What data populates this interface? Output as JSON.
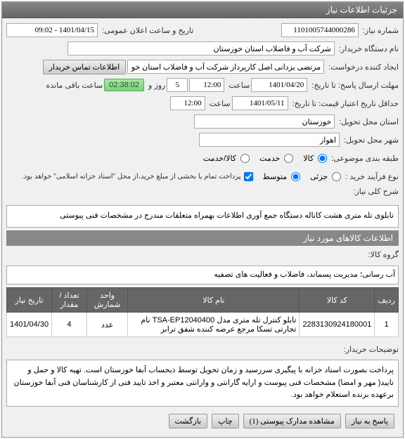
{
  "panel": {
    "title": "جزئیات اطلاعات نیاز"
  },
  "fields": {
    "need_no_label": "شماره نیاز:",
    "need_no": "1101005744000286",
    "announce_label": "تاریخ و ساعت اعلان عمومی:",
    "announce_value": "1401/04/15 - 09:02",
    "buyer_org_label": "نام دستگاه خریدار:",
    "buyer_org": "شرکت آب و فاضلاب استان خوزستان",
    "requester_label": "ایجاد کننده درخواست:",
    "requester": "مرتضی یزدانی اصل کارپرداز شرکت آب و فاضلاب استان خوزستان",
    "contact_btn": "اطلاعات تماس خریدار",
    "deadline_label": "مهلت ارسال پاسخ: تا تاریخ:",
    "deadline_date": "1401/04/20",
    "time_label": "ساعت",
    "deadline_time": "12:00",
    "day_label": "روز و",
    "days": "5",
    "remaining_label": "ساعت باقی مانده",
    "remaining": "02:38:02",
    "validity_label": "حداقل تاریخ اعتبار قیمت: تا تاریخ:",
    "validity_date": "1401/05/11",
    "validity_time": "12:00",
    "delivery_prov_label": "استان محل تحویل:",
    "delivery_prov": "خوزستان",
    "delivery_city_label": "شهر محل تحویل:",
    "delivery_city": "اهواز",
    "classify_label": "طبقه بندی موضوعی:",
    "class_goods": "کالا",
    "class_service": "خدمت",
    "class_both": "کالا/خدمت",
    "purchase_type_label": "نوع فرآیند خرید :",
    "pt_low": "جزئی",
    "pt_med": "متوسط",
    "purchase_note": "پرداخت تمام یا بخشی از مبلغ خرید،از محل \"اسناد خزانه اسلامی\" خواهد بود.",
    "need_title_label": "شرح کلی نیاز:",
    "need_title": "تابلوی تله متری هشت کاناله دستگاه جمع آوری اطلاعات بهمراه متعلقات مندرج در مشخصات فنی پیوستی"
  },
  "goods_section": "اطلاعات کالاهای مورد نیاز",
  "goods_group_label": "گروه کالا:",
  "goods_group": "آب رسانی؛ مدیریت پسماند، فاضلاب و فعالیت های تصفیه",
  "table": {
    "headers": {
      "row": "ردیف",
      "code": "کد کالا",
      "name": "نام کالا",
      "unit": "واحد شمارش",
      "qty": "تعداد / مقدار",
      "date": "تاریخ نیاز"
    },
    "rows": [
      {
        "idx": "1",
        "code": "2283130924180001",
        "name": "تابلو کنترل تله متری مدل TSA-EP12040400 نام تجارتی تسکا مرجع عرضه کننده شفق ترابر",
        "unit": "عدد",
        "qty": "4",
        "date": "1401/04/30"
      }
    ]
  },
  "buyer_notes_label": "توضیحات خریدار:",
  "buyer_notes": "پرداخت بصورت اسناد خزانه با پیگیری سررسید و زمان تحویل توسط ذیحساب آبفا خوزستان است. تهیه کالا و حمل و تایید( مهر و امضا) مشخصات فنی پیوست و ارایه گارانتی و وارانتی معتبر و اخذ تایید فنی از کارشناسان فنی آبفا خوزستان برعهده برنده استعلام خواهد بود.",
  "footer": {
    "reply": "پاسخ به نیاز",
    "attachments": "مشاهده مدارک پیوستی (1)",
    "print": "چاپ",
    "back": "بازگشت"
  }
}
